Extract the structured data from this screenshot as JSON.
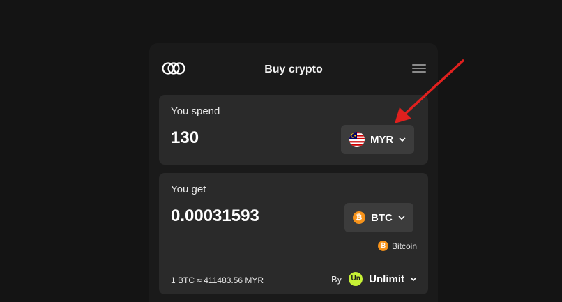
{
  "header": {
    "title": "Buy crypto",
    "logo_icon": "overlapping-circles-logo",
    "menu_icon": "hamburger-menu-icon"
  },
  "spend": {
    "label": "You spend",
    "amount": "130",
    "currency": {
      "code": "MYR",
      "icon": "malaysia-flag-icon"
    }
  },
  "get": {
    "label": "You get",
    "amount": "0.00031593",
    "currency": {
      "code": "BTC",
      "icon": "bitcoin-icon",
      "icon_glyph": "₿"
    },
    "network": "Bitcoin"
  },
  "footer": {
    "rate": "1 BTC ≈ 411483.56 MYR",
    "by_label": "By",
    "provider_name": "Unlimit",
    "provider_logo_text": "Un"
  },
  "colors": {
    "background": "#141414",
    "card": "#2a2a2a",
    "button": "#3c3c3c",
    "bitcoin": "#f7931a",
    "unlimit": "#c6f135",
    "annotation_arrow": "#e0201e"
  }
}
